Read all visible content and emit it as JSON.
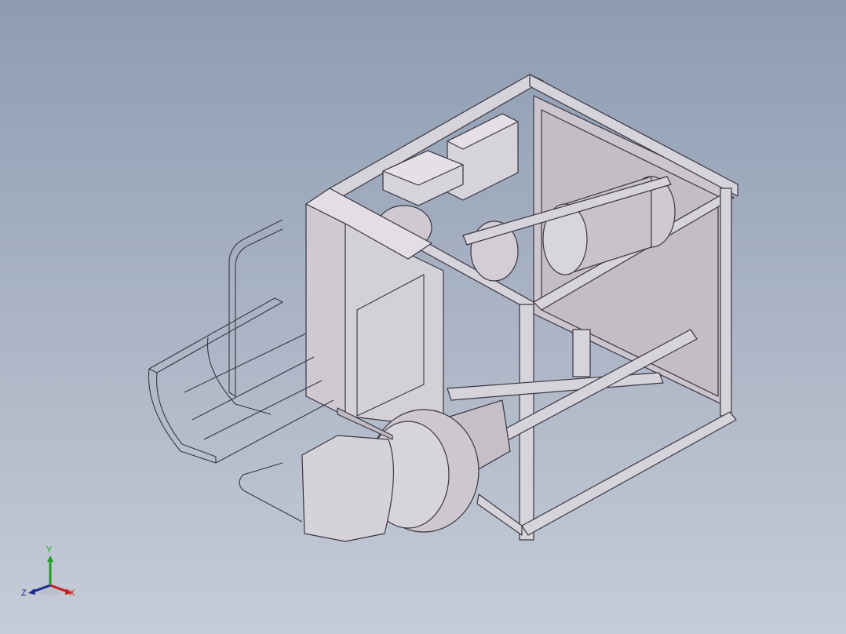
{
  "viewport": {
    "background_top": "#8e9cb2",
    "background_bottom": "#c6ccd7",
    "model_face_color": "#d7d3da",
    "model_shade_color": "#b8b1bc",
    "model_edge_color": "#3a3540"
  },
  "triad": {
    "x_label": "X",
    "y_label": "Y",
    "z_label": "Z",
    "x_color": "#c41e1e",
    "y_color": "#1fa01f",
    "z_color": "#1d2a8c"
  }
}
